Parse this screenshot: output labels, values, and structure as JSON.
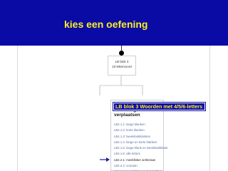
{
  "banner": {
    "title": "kies een oefening",
    "bg_color": "#0a0aa5",
    "text_color": "#ffee22"
  },
  "tree_node": {
    "title": "LB blok 3",
    "subtitle": "23 lettervoord"
  },
  "tooltip": {
    "text": "LB blok 3 Woorden met 4/5/6-letters"
  },
  "panel": {
    "header": "Klik op een blok om de leering te verplaatsen",
    "items": [
      {
        "label": "LB4.1.1: lange klanken",
        "active": false
      },
      {
        "label": "LB4.1.2: korte klanken",
        "active": false
      },
      {
        "label": "LB4.1.3: tweeklankklanken",
        "active": false
      },
      {
        "label": "LB4.1.4: lange en korte klanken",
        "active": false
      },
      {
        "label": "LB4.1.5: lange klank en tweeklankklank",
        "active": false
      },
      {
        "label": "LB4.1.6: alle letters",
        "active": false
      },
      {
        "label": "LB4.2.1: meeklinker achteraan",
        "active": true
      },
      {
        "label": "LB4.2.2: vooraan",
        "active": false
      },
      {
        "label": "LB4.2.3: meeklinkers in het midden",
        "active": false
      }
    ]
  },
  "icons": {
    "pointer": "arrow-right-icon",
    "node_dot": "dot-icon"
  }
}
